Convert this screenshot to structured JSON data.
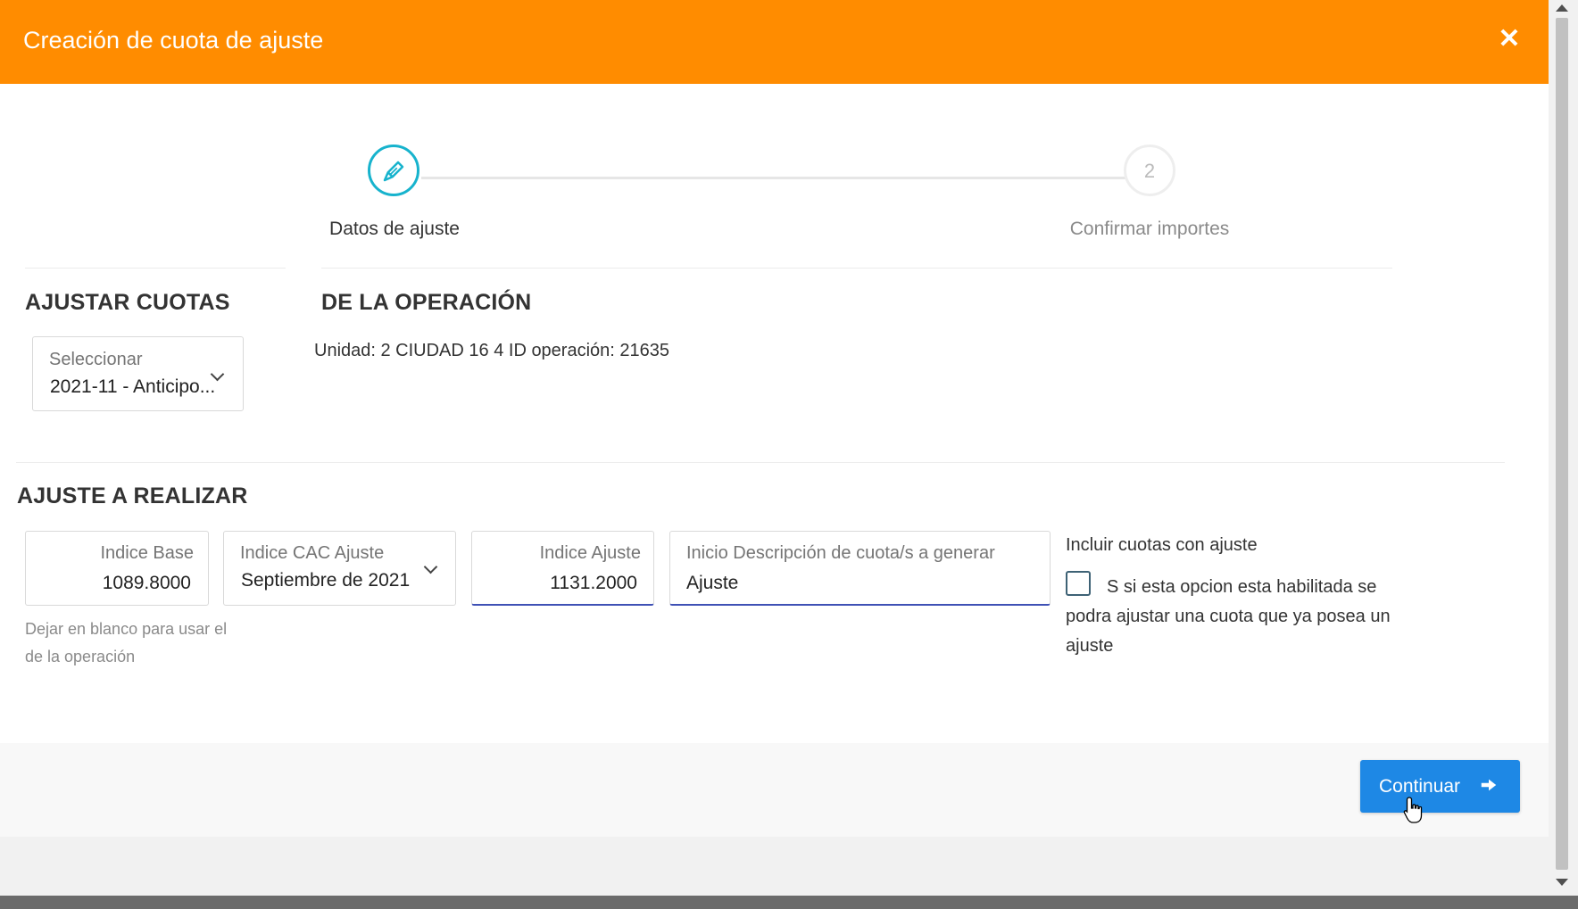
{
  "header": {
    "title": "Creación de cuota de ajuste",
    "close_icon": "close-icon"
  },
  "stepper": {
    "step1": {
      "label": "Datos de ajuste",
      "icon": "pencil-icon",
      "active": true
    },
    "step2": {
      "number": "2",
      "label": "Confirmar importes",
      "active": false
    }
  },
  "ajustar_cuotas": {
    "title": "AJUSTAR CUOTAS",
    "select": {
      "label": "Seleccionar",
      "value": "2021-11 - Anticipo..."
    }
  },
  "operacion": {
    "title": "DE LA OPERACIÓN",
    "info": "Unidad: 2 CIUDAD 16 4 ID operación: 21635"
  },
  "ajuste": {
    "title": "AJUSTE A REALIZAR",
    "indice_base": {
      "label": "Indice Base",
      "value": "1089.8000",
      "hint": "Dejar en blanco para usar el de la operación"
    },
    "indice_cac": {
      "label": "Indice CAC Ajuste",
      "value": "Septiembre de 2021"
    },
    "indice_ajuste": {
      "label": "Indice Ajuste",
      "value": "1131.2000"
    },
    "descripcion": {
      "label": "Inicio Descripción de cuota/s a generar",
      "value": "Ajuste"
    },
    "incluir": {
      "title": "Incluir cuotas con ajuste",
      "text": "S si esta opcion esta habilitada se podra ajustar una cuota que ya posea un ajuste",
      "checked": false
    }
  },
  "footer": {
    "continue_label": "Continuar",
    "continue_icon": "arrow-right-icon"
  },
  "colors": {
    "header": "#ff8c00",
    "accent": "#17b3cd",
    "primary_button": "#1e88e5"
  }
}
